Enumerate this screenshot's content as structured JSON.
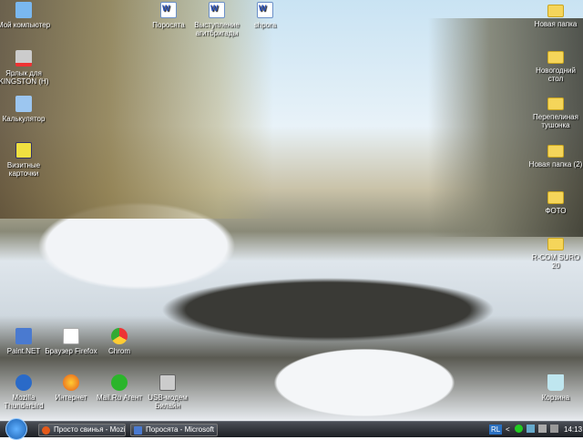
{
  "desktop_icons_left": [
    {
      "label": "Мой компьютер",
      "icon": "computer-icon"
    },
    {
      "label": "Ярлык для KINGSTON (H)",
      "icon": "drive-shortcut-icon"
    },
    {
      "label": "Калькулятор",
      "icon": "calculator-icon"
    },
    {
      "label": "Визитные карточки",
      "icon": "business-cards-icon"
    }
  ],
  "desktop_icons_top": [
    {
      "label": "Поросята",
      "icon": "word-document-icon"
    },
    {
      "label": "Выступление агитбригады",
      "icon": "word-document-icon"
    },
    {
      "label": "shpora",
      "icon": "word-document-icon"
    }
  ],
  "desktop_icons_right": [
    {
      "label": "Новая папка",
      "icon": "folder-icon"
    },
    {
      "label": "Новогодний стол",
      "icon": "folder-icon"
    },
    {
      "label": "Перепелиная тушонка",
      "icon": "folder-icon"
    },
    {
      "label": "Новая папка (2)",
      "icon": "folder-icon"
    },
    {
      "label": "ФОТО",
      "icon": "folder-icon"
    },
    {
      "label": "R-COM SURO 20",
      "icon": "folder-icon"
    }
  ],
  "desktop_icons_bottom": [
    {
      "label": "Paint.NET",
      "icon": "paint-net-icon"
    },
    {
      "label": "Браузер Firefox",
      "icon": "firefox-icon"
    },
    {
      "label": "Chrom",
      "icon": "chrome-icon"
    },
    {
      "label": "Mozilla Thunderbird",
      "icon": "thunderbird-icon"
    },
    {
      "label": "Интернет",
      "icon": "firefox-icon"
    },
    {
      "label": "Mail.Ru Агент",
      "icon": "mail-agent-icon"
    },
    {
      "label": "USB-модем Билайн",
      "icon": "usb-modem-icon"
    }
  ],
  "recycle_bin": {
    "label": "Корзина",
    "icon": "recycle-bin-icon"
  },
  "taskbar": {
    "tasks": [
      {
        "label": "Просто свинья - Mozil..."
      },
      {
        "label": "Поросята - Microsoft ..."
      }
    ],
    "tray": {
      "lang": "RL",
      "time": "14:13"
    }
  }
}
